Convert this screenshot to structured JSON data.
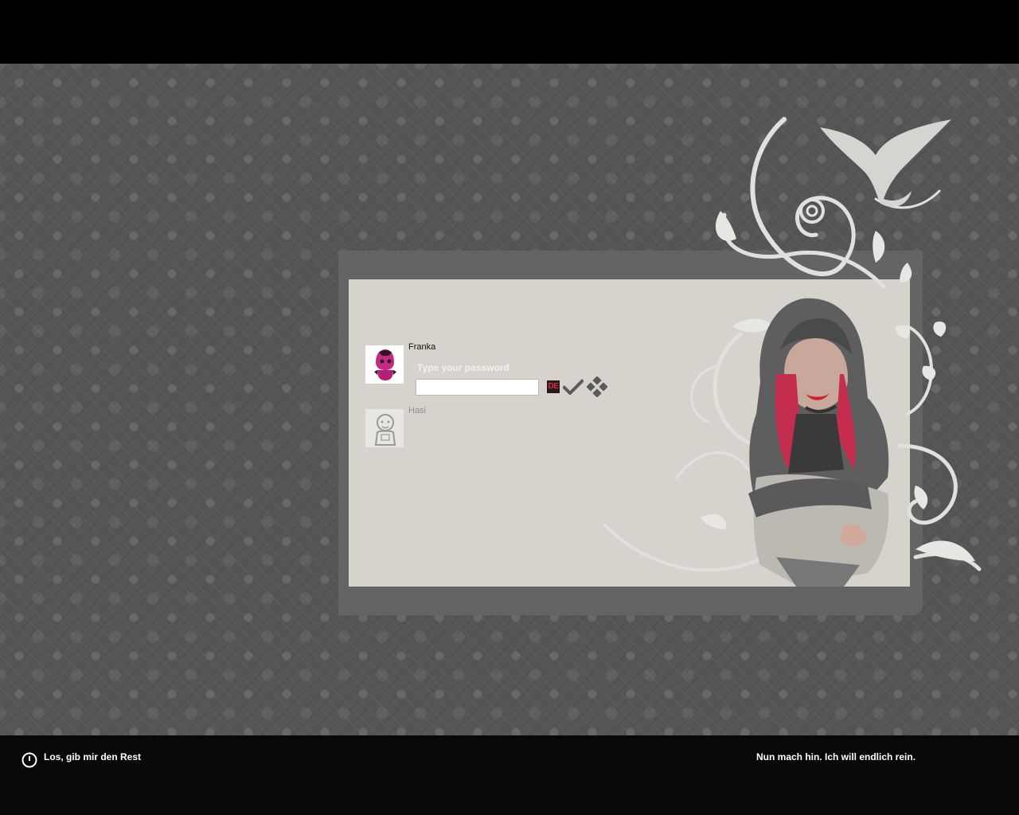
{
  "login": {
    "users": [
      {
        "name": "Franka",
        "avatar_icon": "pink-hoodie-figure-icon",
        "selected": true
      },
      {
        "name": "Hasi",
        "avatar_icon": "grey-figure-icon",
        "selected": false
      }
    ],
    "password_label": "Type your password",
    "password_value": "",
    "keyboard_layout": "DE",
    "submit_icon": "checkmark-icon",
    "options_icon": "diamond-grid-icon"
  },
  "bottom_bar": {
    "shutdown_label": "Los, gib mir den Rest",
    "status_text": "Nun mach hin. Ich will endlich rein."
  },
  "colors": {
    "wallpaper": "#555555",
    "frame": "#646464",
    "panel": "#d6d3cd",
    "accent_pink": "#c42a83",
    "lang_red": "#e5263a"
  }
}
